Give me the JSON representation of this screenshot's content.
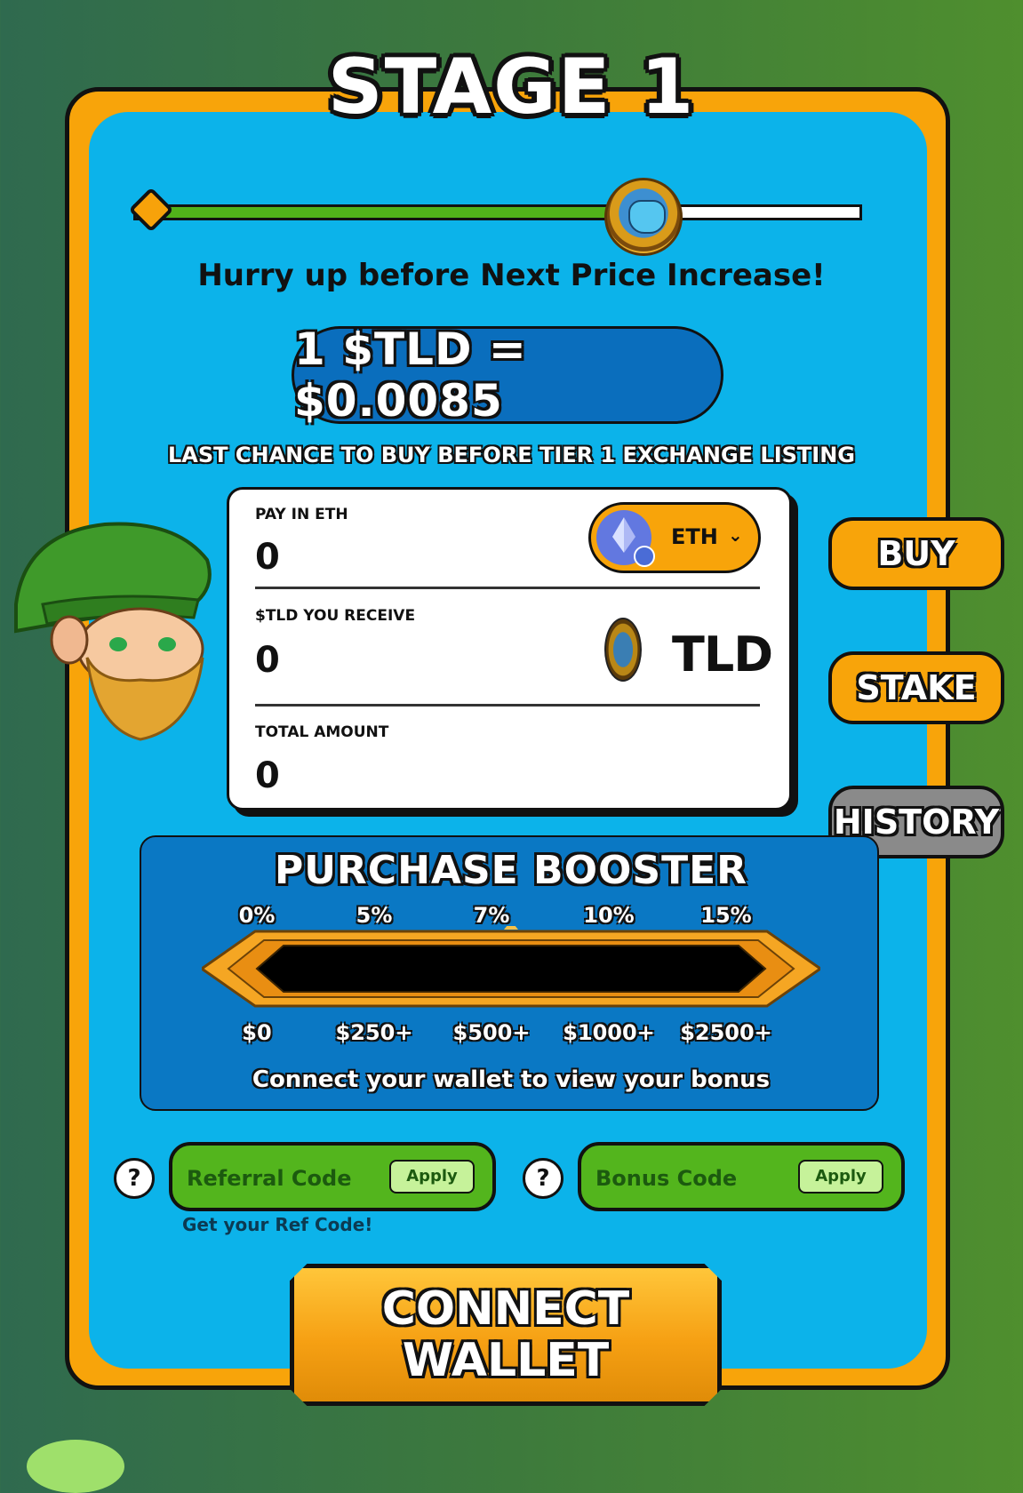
{
  "stage": {
    "title": "STAGE 1"
  },
  "progress": {
    "fraction": 0.7
  },
  "hurry_text": "Hurry up before Next Price Increase!",
  "price": {
    "text": "1 $TLD = $0.0085"
  },
  "last_chance": "LAST CHANCE TO BUY BEFORE TIER 1 EXCHANGE LISTING",
  "form": {
    "pay_label": "PAY IN ETH",
    "pay_value": "0",
    "currency": "ETH",
    "receive_label": "$TLD YOU RECEIVE",
    "receive_value": "0",
    "token": "TLD",
    "total_label": "TOTAL AMOUNT",
    "total_value": "0"
  },
  "side_buttons": {
    "buy": "BUY",
    "stake": "STAKE",
    "history": "HISTORY"
  },
  "booster": {
    "title": "PURCHASE BOOSTER",
    "percents": [
      "0%",
      "5%",
      "7%",
      "10%",
      "15%"
    ],
    "amounts": [
      "$0",
      "$250+",
      "$500+",
      "$1000+",
      "$2500+"
    ],
    "connect_text": "Connect your wallet to view your bonus",
    "fill_fraction": 0
  },
  "referral": {
    "placeholder": "Referral Code",
    "apply": "Apply",
    "help": "?",
    "link": "Get your Ref Code!"
  },
  "bonus": {
    "placeholder": "Bonus Code",
    "apply": "Apply",
    "help": "?"
  },
  "connect_wallet": {
    "label": "CONNECT\nWALLET"
  },
  "colors": {
    "orange": "#f8a40a",
    "panel_blue": "#0cb3ea",
    "green": "#53b51d",
    "dark_blue": "#0a6ebd"
  },
  "icons": [
    "ethereum-icon",
    "chevron-down-icon",
    "tld-coin-icon",
    "progress-coin-icon",
    "help-icon"
  ]
}
